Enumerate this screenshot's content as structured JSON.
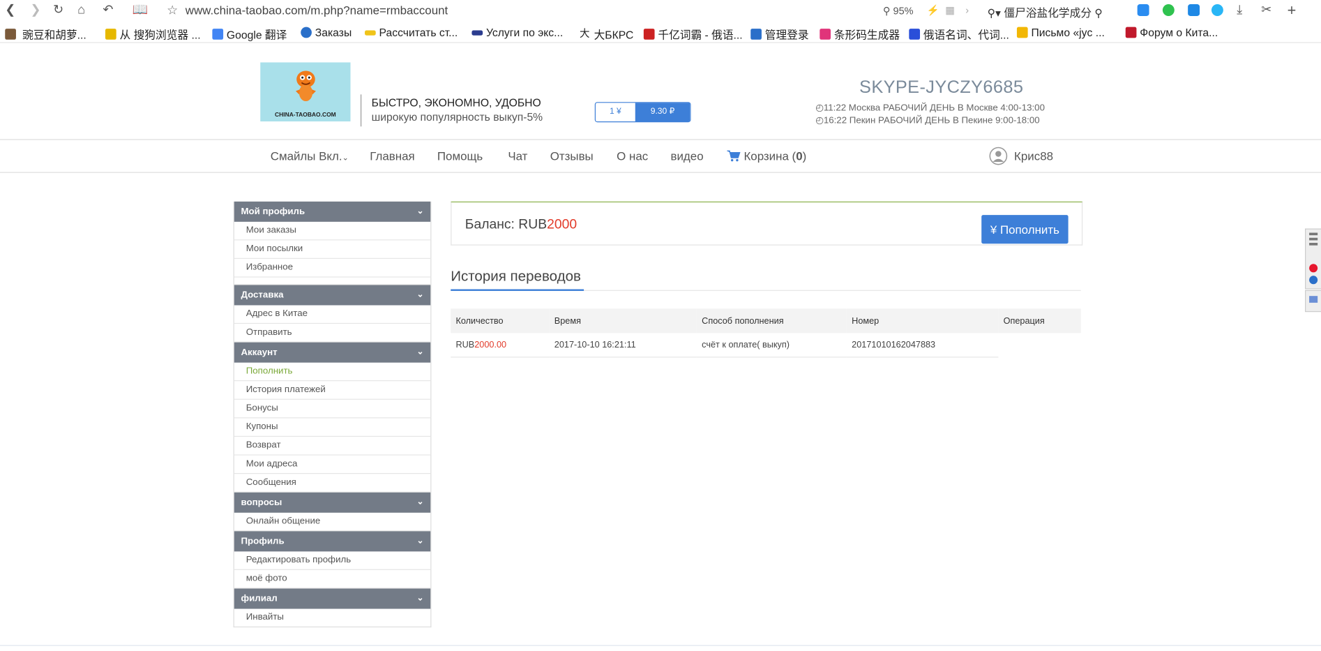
{
  "browser": {
    "url": "www.china-taobao.com/m.php?name=rmbaccount",
    "zoom": "95%",
    "search_text": "僵尸浴盐化学成分",
    "bookmarks": [
      {
        "label": "豌豆和胡萝...",
        "color": "#7b5a3a"
      },
      {
        "label": "从 搜狗浏览器 ...",
        "color": "#e6b800"
      },
      {
        "label": "Google 翻译",
        "color": "#4285f4"
      },
      {
        "label": "Заказы",
        "color": "#2a6fc9"
      },
      {
        "label": "Рассчитать ст...",
        "color": "#f0c419"
      },
      {
        "label": "Услуги по экс...",
        "color": "#2b3c8f"
      },
      {
        "label": "大БКРС",
        "color": "#222222"
      },
      {
        "label": "千亿词霸 - 俄语...",
        "color": "#cc2222"
      },
      {
        "label": "管理登录",
        "color": "#2a6fc9"
      },
      {
        "label": "条形码生成器",
        "color": "#e0347a"
      },
      {
        "label": "俄语名词、代词...",
        "color": "#2a4fd9"
      },
      {
        "label": "Письмо «jyc ...",
        "color": "#f2b705"
      },
      {
        "label": "Форум о Кита...",
        "color": "#c0192b"
      }
    ]
  },
  "header": {
    "logo_caption": "CHINA-TAOBAO.COM",
    "slogan_main": "БЫСТРО, ЭКОНОМНО, УДОБНО",
    "slogan_sub": "широкую популярность выкуп-5%",
    "rate_left": "1 ¥",
    "rate_right": "9.30 ₽",
    "skype": "SKYPE-JYCZY6685",
    "time_moscow": "◴11:22  Москва  РАБОЧИЙ ДЕНЬ В Москве 4:00-13:00",
    "time_beijing": "◴16:22  Пекин    РАБОЧИЙ ДЕНЬ В Пекине 9:00-18:00"
  },
  "nav": {
    "smiles": "Смайлы Вкл.",
    "home": "Главная",
    "help": "Помощь",
    "chat": "Чат",
    "reviews": "Отзывы",
    "about": "О нас",
    "video": "видео",
    "cart": "Корзина (",
    "cart_count": "0",
    "cart_close": ")",
    "user": "Крис88"
  },
  "sidebar": {
    "profile_title": "Мой профиль",
    "profile_items": [
      "Мои заказы",
      "Мои посылки",
      "Избранное"
    ],
    "delivery_title": "Доставка",
    "delivery_items": [
      "Адрес в Китае",
      "Отправить"
    ],
    "account_title": "Аккаунт",
    "account_items": [
      "Пополнить",
      "История платежей",
      "Бонусы",
      "Купоны",
      "Возврат",
      "Мои адреса",
      "Сообщения"
    ],
    "questions_title": "вопросы",
    "questions_items": [
      "Онлайн общение"
    ],
    "profile2_title": "Профиль",
    "profile2_items": [
      "Редактировать профиль",
      "моё фото"
    ],
    "branch_title": "филиал",
    "branch_items": [
      "Инвайты"
    ]
  },
  "balance": {
    "label": "Баланс: RUB",
    "value": "2000",
    "topup_button": "¥ Пополнить"
  },
  "history": {
    "title": "История переводов",
    "columns": [
      "Количество",
      "Время",
      "Способ пополнения",
      "Номер",
      "Операция"
    ],
    "rows": [
      {
        "currency": "RUB",
        "amount": "2000.00",
        "time": "2017-10-10 16:21:11",
        "method": "счёт к оплате( выкуп)",
        "number": "20171010162047883",
        "operation": ""
      }
    ]
  },
  "colors": {
    "accent": "#3d7fd8",
    "sidebar_header": "#737b87",
    "money_red": "#e23b2a",
    "active_green": "#7aa838"
  }
}
